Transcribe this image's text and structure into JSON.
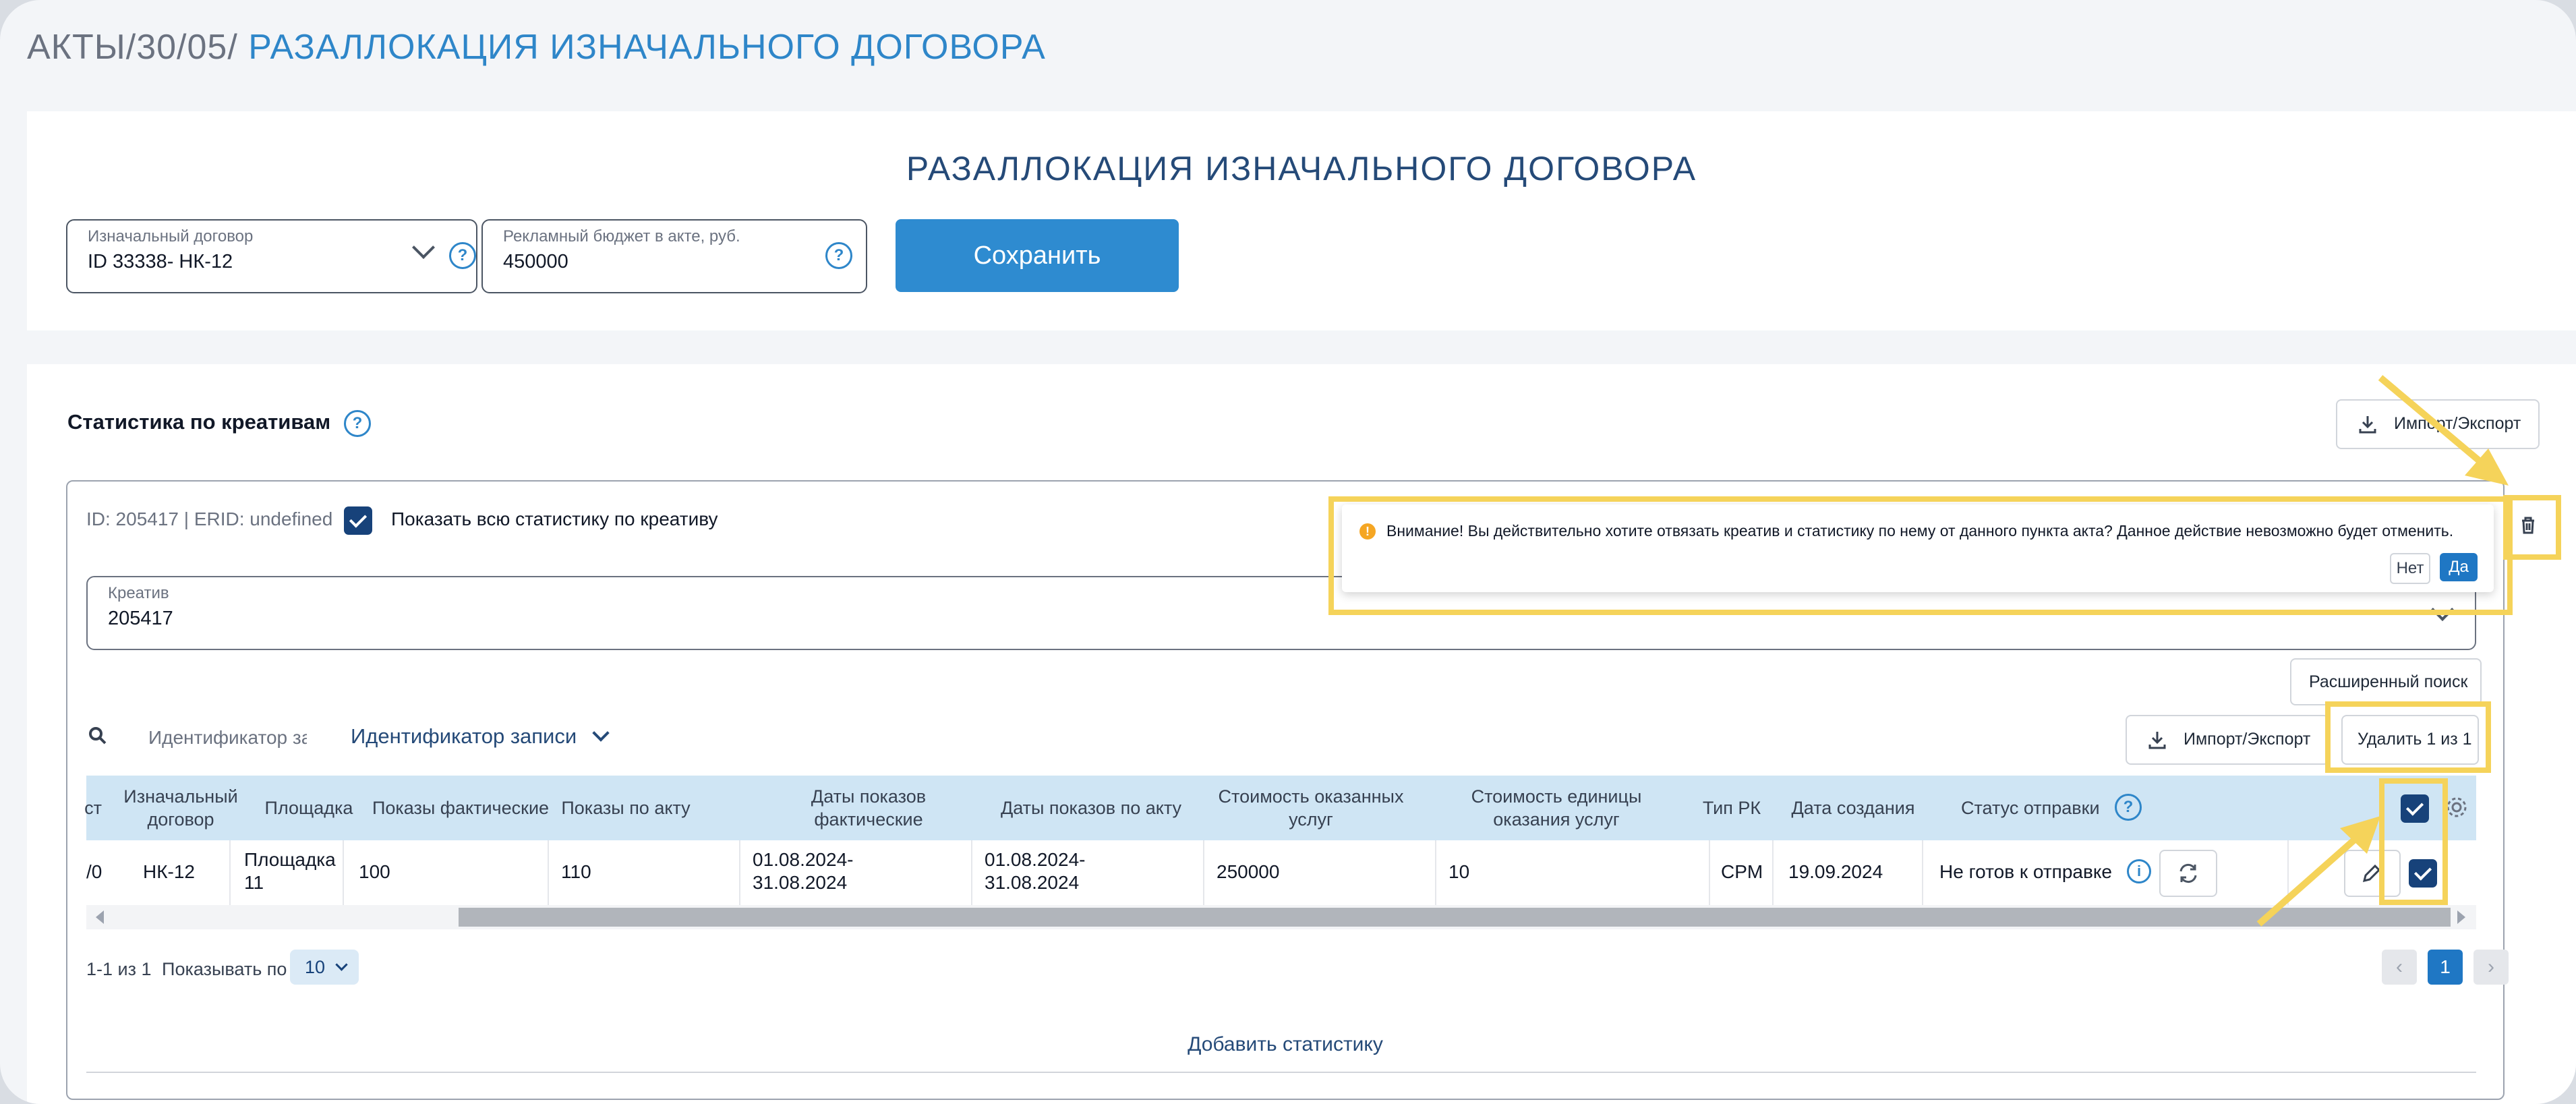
{
  "breadcrumb": {
    "part1": "АКТЫ/",
    "part2": "30/05/",
    "current": "РАЗАЛЛОКАЦИЯ ИЗНАЧАЛЬНОГО ДОГОВОРА"
  },
  "form": {
    "title": "РАЗАЛЛОКАЦИЯ ИЗНАЧАЛЬНОГО ДОГОВОРА",
    "contract_label": "Изначальный договор",
    "contract_value": "ID 33338- НК-12",
    "budget_label": "Рекламный бюджет в акте, руб.",
    "budget_value": "450000",
    "save_label": "Сохранить"
  },
  "stats": {
    "heading": "Статистика по креативам",
    "import_export": "Импорт/Экспорт",
    "id_line": "ID: 205417 | ERID: undefined",
    "show_all_label": "Показать всю статистику по креативу",
    "creative_label": "Креатив",
    "creative_value": "205417",
    "advanced_search": "Расширенный поиск",
    "search_placeholder": "Идентификатор зап",
    "search_field_select": "Идентификатор записи",
    "import_export_2": "Импорт/Экспорт",
    "delete_btn": "Удалить 1 из 1",
    "pagination_info": "1-1 из 1",
    "show_by_label": "Показывать по",
    "page_size": "10",
    "current_page": "1",
    "add_stats": "Добавить статистику"
  },
  "warning": {
    "text": "Внимание! Вы действительно хотите отвязать креатив и статистику по нему от данного пункта акта? Данное действие невозможно будет отменить.",
    "no": "Нет",
    "yes": "Да"
  },
  "table": {
    "headers": {
      "c0": "ст",
      "c1": "Изначальный договор",
      "c2": "Площадка",
      "c3": "Показы фактические",
      "c4": "Показы по акту",
      "c5": "Даты показов фактические",
      "c6": "Даты показов по акту",
      "c7": "Стоимость оказанных услуг",
      "c8": "Стоимость единицы оказания услуг",
      "c9": "Тип РК",
      "c10": "Дата создания",
      "c11": "Статус отправки"
    },
    "row": {
      "c0": "/0",
      "c1": "НК-12",
      "c2": "Площадка 11",
      "c3": "100",
      "c4": "110",
      "c5": "01.08.2024-31.08.2024",
      "c6": "01.08.2024-31.08.2024",
      "c7": "250000",
      "c8": "10",
      "c9": "CPM",
      "c10": "19.09.2024",
      "c11": "Не готов к отправке"
    }
  },
  "colors": {
    "primary": "#2e8bd0",
    "brand_dark": "#17427a",
    "highlight": "#f5d35a",
    "header_bg": "#cfe5f4",
    "warning": "#f5a623"
  }
}
